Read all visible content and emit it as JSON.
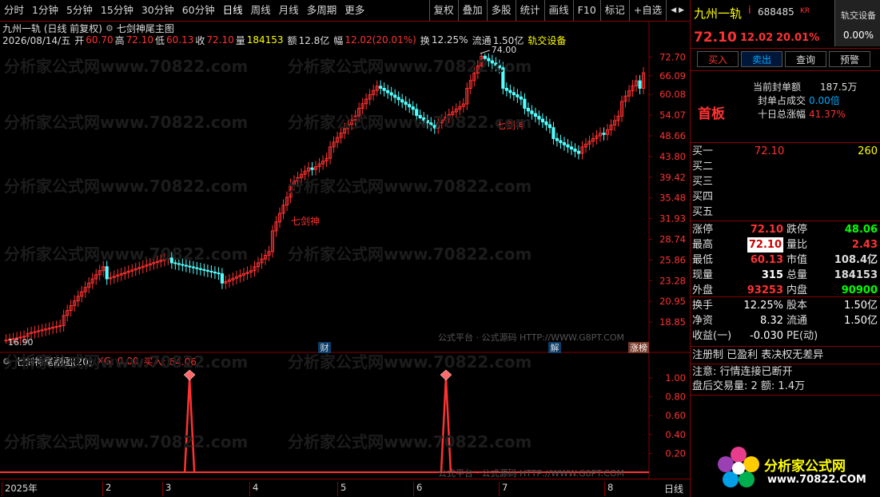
{
  "toolbar": {
    "left": [
      "分时",
      "1分钟",
      "5分钟",
      "15分钟",
      "30分钟",
      "60分钟",
      "日线",
      "周线",
      "月线",
      "多周期",
      "更多"
    ],
    "active": "日线",
    "right": [
      "复权",
      "叠加",
      "多股",
      "统计",
      "画线",
      "F10",
      "标记",
      "+自选"
    ],
    "nav": "◀ ▶"
  },
  "chart": {
    "title": "九州一轨 (日线 前复权)",
    "indicator_main": "七剑神尾主图",
    "quote": {
      "date": "2026/08/14/五",
      "open_label": "开",
      "open": "60.70",
      "high_label": "高",
      "high": "72.10",
      "low_label": "低",
      "low": "60.13",
      "close_label": "收",
      "close": "72.10",
      "vol_label": "量",
      "vol": "184153",
      "amt_label": "额",
      "amt": "12.8亿",
      "chg_label": "幅",
      "chg": "12.02(20.01%)",
      "turn_label": "换",
      "turn": "12.25%",
      "float_label": "流通",
      "float": "1.50亿",
      "tag": "轨交设备"
    },
    "price_axis": [
      "72.70",
      "66.09",
      "60.08",
      "54.07",
      "48.66",
      "43.80",
      "39.42",
      "35.48",
      "31.93",
      "28.74",
      "25.86",
      "23.28",
      "20.95",
      "18.85"
    ],
    "markers": {
      "high": "74.00",
      "low": "16.90",
      "signal1": "七剑神",
      "signal2": "七剑神"
    },
    "events": [
      "财",
      "解",
      "涨榜"
    ],
    "sub_title": "七剑神尾副图(20)",
    "sub_xg": "XG: 0.00",
    "sub_buy": "买入: 64.06",
    "sub_axis": [
      "1.00",
      "0.80",
      "0.60",
      "0.40",
      "0.20"
    ],
    "x_axis": [
      "2025年",
      "2",
      "3",
      "4",
      "5",
      "6",
      "7",
      "8"
    ],
    "period_label": "日线",
    "watermark_site": "分析家公式网www.70822.com",
    "watermark_src": "公式平台 · 公式源码 HTTP://WWW.G8PT.COM"
  },
  "chart_data": [
    {
      "type": "candlestick",
      "title": "九州一轨 (日线 前复权)",
      "ylim": [
        16.9,
        74.0
      ],
      "x_labels": [
        "2025年",
        "2",
        "3",
        "4",
        "5",
        "6",
        "7",
        "8"
      ],
      "last": {
        "date": "2026/08/14",
        "open": 60.7,
        "high": 72.1,
        "low": 60.13,
        "close": 72.1
      },
      "highest": 74.0,
      "lowest": 16.9
    },
    {
      "type": "line",
      "title": "七剑神尾副图(20)",
      "ylim": [
        0,
        1
      ],
      "series": [
        {
          "name": "XG",
          "values": [
            0,
            0,
            0,
            0,
            0,
            0,
            0,
            0,
            0,
            0,
            1,
            0,
            0,
            0,
            0,
            0,
            0,
            0,
            0,
            0,
            0,
            0,
            0,
            0,
            1,
            0,
            0,
            0,
            0,
            0,
            0,
            0,
            0,
            0,
            0,
            0
          ]
        }
      ]
    }
  ],
  "panel": {
    "name": "九州一轨",
    "code": "688485",
    "kr": "KR",
    "sector": "轨交设备",
    "sector_pct": "0.00%",
    "price": "72.10",
    "change": "12.02",
    "pct": "20.01%",
    "buttons": [
      "买入",
      "卖出",
      "查询",
      "预警"
    ],
    "seal_amount_label": "当前封单额",
    "seal_amount": "187.5万",
    "seal_ratio_label": "封单占成交",
    "seal_ratio": "0.00倍",
    "ten_day_label": "十日总涨幅",
    "ten_day": "41.37%",
    "board": "首板",
    "bids": [
      {
        "label": "买一",
        "price": "72.10",
        "vol": "260"
      },
      {
        "label": "买二",
        "price": "",
        "vol": ""
      },
      {
        "label": "买三",
        "price": "",
        "vol": ""
      },
      {
        "label": "买四",
        "price": "",
        "vol": ""
      },
      {
        "label": "买五",
        "price": "",
        "vol": ""
      }
    ],
    "stats": [
      {
        "l1": "涨停",
        "v1": "72.10",
        "l2": "跌停",
        "v2": "48.06"
      },
      {
        "l1": "最高",
        "v1": "72.10",
        "l2": "量比",
        "v2": "2.43"
      },
      {
        "l1": "最低",
        "v1": "60.13",
        "l2": "市值",
        "v2": "108.4亿"
      },
      {
        "l1": "现量",
        "v1": "315",
        "l2": "总量",
        "v2": "184153"
      },
      {
        "l1": "外盘",
        "v1": "93253",
        "l2": "内盘",
        "v2": "90900"
      }
    ],
    "stats2": [
      {
        "l1": "换手",
        "v1": "12.25%",
        "l2": "股本",
        "v2": "1.50亿"
      },
      {
        "l1": "净资",
        "v1": "8.32",
        "l2": "流通",
        "v2": "1.50亿"
      },
      {
        "l1": "收益(一)",
        "v1": "-0.030",
        "l2": "PE(动)",
        "v2": ""
      }
    ],
    "notice1": "注册制 已盈利 表决权无差异",
    "notice2": "注意: 行情连接已断开",
    "notice3": "盘后交易量: 2  额: 1.4万",
    "logo_text": "分析家公式网",
    "logo_url": "www.70822.COM"
  },
  "colors": {
    "up": "#ff3232",
    "down": "#54ffff",
    "bg": "#000000",
    "border": "#800000"
  }
}
